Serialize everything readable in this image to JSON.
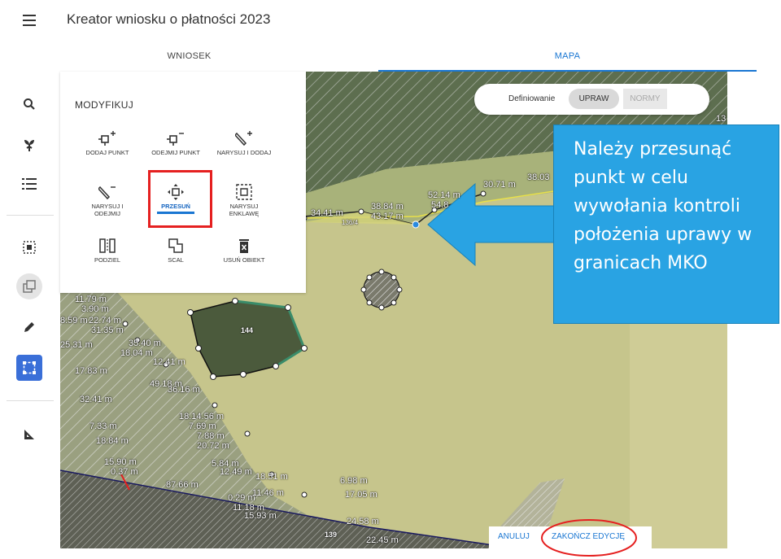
{
  "header": {
    "title": "Kreator wniosku o płatności 2023"
  },
  "tabs": [
    {
      "label": "WNIOSEK"
    },
    {
      "label": "MAPA"
    }
  ],
  "panel": {
    "title": "MODYFIKUJ",
    "tools": [
      {
        "label": "DODAJ PUNKT"
      },
      {
        "label": "ODEJMIJ PUNKT"
      },
      {
        "label": "NARYSUJ I DODAJ"
      },
      {
        "label": "NARYSUJ I ODEJMIJ"
      },
      {
        "label": "PRZESUŃ"
      },
      {
        "label": "NARYSUJ ENKLAWĘ"
      },
      {
        "label": "PODZIEL"
      },
      {
        "label": "SCAL"
      },
      {
        "label": "USUŃ OBIEKT"
      }
    ]
  },
  "definition": {
    "label": "Definiowanie",
    "option1": "UPRAW",
    "option2": "NORMY"
  },
  "callout": {
    "text": "Należy przesunąć punkt w celu wywołania kontroli położenia uprawy w granicach MKO"
  },
  "map": {
    "labels": [
      "11.79 m",
      "3.90 m",
      "8.59 m",
      "22.74 m",
      "31.35 m",
      "25.31 m",
      "35.40 m",
      "18.04 m",
      "12.41 m",
      "17.83 m",
      "49.18 m",
      "36.16 m",
      "32.41 m",
      "18.14.56 m",
      "7.69 m",
      "7.33 m",
      "7.88 m",
      "18.84 m",
      "20.72 m",
      "15.90 m",
      "0.37 m",
      "5.84 m",
      "12.49 m",
      "18.51 m",
      "87.66 m",
      "0.29 m",
      "11.46 m",
      "11.18 m",
      "15.93 m",
      "17.05 m",
      "24.58 m",
      "22.45 m",
      "34.41 m",
      "38.84 m",
      "43.17 m",
      "52.14 m",
      "54.8",
      "30.71 m",
      "38.03",
      "136/4",
      "144",
      "139",
      "13",
      "6.98 m"
    ]
  },
  "actions": {
    "cancel": "ANULUJ",
    "finish": "ZAKOŃCZ EDYCJĘ"
  },
  "colors": {
    "accent": "#1976d2",
    "callout": "#29a3e3",
    "highlight": "#e52020",
    "sidebar_active": "#3a6fd8"
  }
}
